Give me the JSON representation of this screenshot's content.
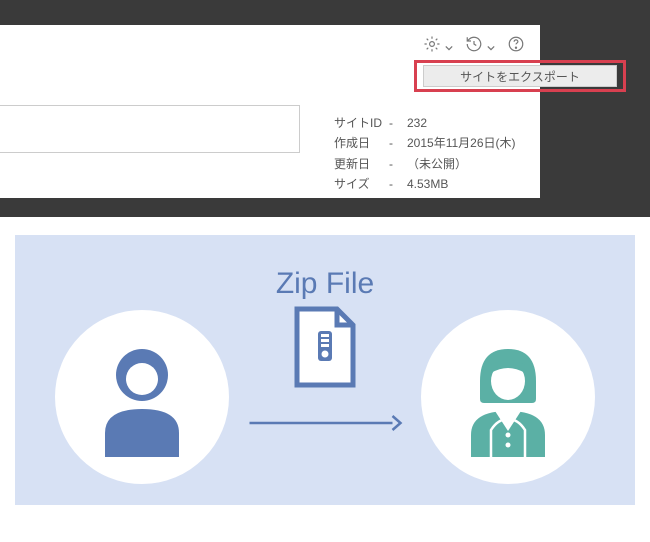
{
  "toolbar": {
    "export_button_label": "サイトをエクスポート"
  },
  "metadata": {
    "rows": [
      {
        "label": "サイトID",
        "value": "232"
      },
      {
        "label": "作成日",
        "value": "2015年11月26日(木)"
      },
      {
        "label": "更新日",
        "value": "（未公開）"
      },
      {
        "label": "サイズ",
        "value": "4.53MB"
      }
    ]
  },
  "diagram": {
    "zip_title": "Zip File"
  },
  "colors": {
    "accent_blue": "#5a7ab4",
    "person_male": "#5a7ab4",
    "person_female": "#5bb0a5",
    "highlight": "#d84050"
  }
}
